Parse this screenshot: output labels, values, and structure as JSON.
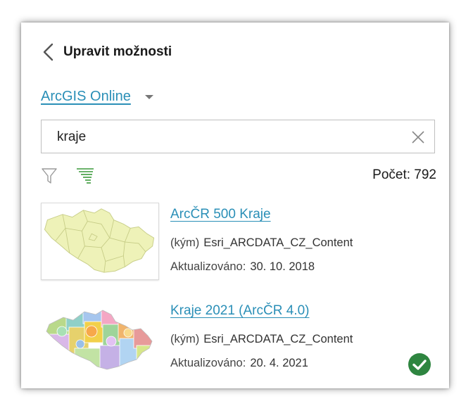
{
  "header": {
    "title": "Upravit možnosti"
  },
  "source": {
    "label": "ArcGIS Online"
  },
  "search": {
    "value": "kraje"
  },
  "results": {
    "count_text": "Počet: 792"
  },
  "items": [
    {
      "title": "ArcČR 500 Kraje",
      "owner_label": "(kým)",
      "owner": "Esri_ARCDATA_CZ_Content",
      "updated_label": "Aktualizováno:",
      "updated": "30. 10. 2018",
      "selected": false
    },
    {
      "title": "Kraje 2021 (ArcČR 4.0)",
      "owner_label": "(kým)",
      "owner": "Esri_ARCDATA_CZ_Content",
      "updated_label": "Aktualizováno:",
      "updated": "20. 4. 2021",
      "selected": true
    }
  ],
  "colors": {
    "link": "#2a8fb7",
    "sort_active": "#3a9a3a",
    "selected_check": "#2e8540",
    "map_fill": "#eef2b8"
  }
}
